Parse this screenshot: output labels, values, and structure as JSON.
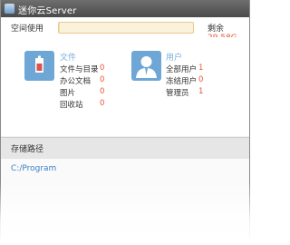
{
  "window": {
    "title": "迷你云Server"
  },
  "space": {
    "label": "空间使用",
    "usage_fraction": 0.01,
    "remaining_label": "剩余",
    "remaining_value": "29.58G"
  },
  "files": {
    "title": "文件",
    "icon": "document-icon",
    "rows": [
      {
        "label": "文件与目录",
        "value": "0"
      },
      {
        "label": "办公文档",
        "value": "0"
      },
      {
        "label": "图片",
        "value": "0"
      },
      {
        "label": "回收站",
        "value": "0"
      }
    ]
  },
  "users": {
    "title": "用户",
    "icon": "user-icon",
    "rows": [
      {
        "label": "全部用户",
        "value": "1"
      },
      {
        "label": "冻结用户",
        "value": "0"
      },
      {
        "label": "管理员",
        "value": "1"
      }
    ]
  },
  "storage": {
    "header": "存储路径",
    "path": "C:/Program"
  },
  "colors": {
    "accent": "#6ea7d6",
    "value": "#e8553a",
    "link": "#3a7fc8"
  }
}
